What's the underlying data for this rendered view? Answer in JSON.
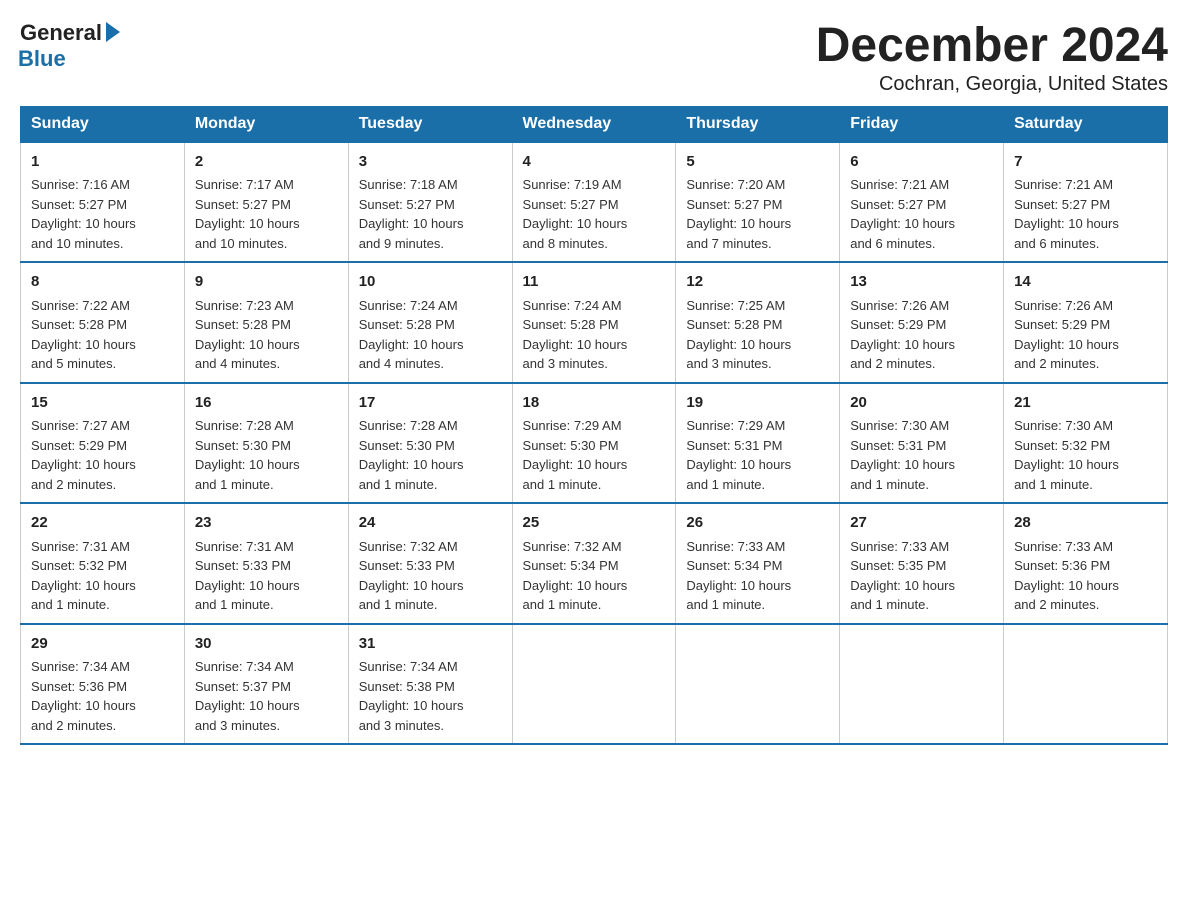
{
  "header": {
    "logo_general": "General",
    "logo_blue": "Blue",
    "month": "December 2024",
    "location": "Cochran, Georgia, United States"
  },
  "days_of_week": [
    "Sunday",
    "Monday",
    "Tuesday",
    "Wednesday",
    "Thursday",
    "Friday",
    "Saturday"
  ],
  "weeks": [
    [
      {
        "day": "1",
        "sunrise": "7:16 AM",
        "sunset": "5:27 PM",
        "daylight": "10 hours and 10 minutes."
      },
      {
        "day": "2",
        "sunrise": "7:17 AM",
        "sunset": "5:27 PM",
        "daylight": "10 hours and 10 minutes."
      },
      {
        "day": "3",
        "sunrise": "7:18 AM",
        "sunset": "5:27 PM",
        "daylight": "10 hours and 9 minutes."
      },
      {
        "day": "4",
        "sunrise": "7:19 AM",
        "sunset": "5:27 PM",
        "daylight": "10 hours and 8 minutes."
      },
      {
        "day": "5",
        "sunrise": "7:20 AM",
        "sunset": "5:27 PM",
        "daylight": "10 hours and 7 minutes."
      },
      {
        "day": "6",
        "sunrise": "7:21 AM",
        "sunset": "5:27 PM",
        "daylight": "10 hours and 6 minutes."
      },
      {
        "day": "7",
        "sunrise": "7:21 AM",
        "sunset": "5:27 PM",
        "daylight": "10 hours and 6 minutes."
      }
    ],
    [
      {
        "day": "8",
        "sunrise": "7:22 AM",
        "sunset": "5:28 PM",
        "daylight": "10 hours and 5 minutes."
      },
      {
        "day": "9",
        "sunrise": "7:23 AM",
        "sunset": "5:28 PM",
        "daylight": "10 hours and 4 minutes."
      },
      {
        "day": "10",
        "sunrise": "7:24 AM",
        "sunset": "5:28 PM",
        "daylight": "10 hours and 4 minutes."
      },
      {
        "day": "11",
        "sunrise": "7:24 AM",
        "sunset": "5:28 PM",
        "daylight": "10 hours and 3 minutes."
      },
      {
        "day": "12",
        "sunrise": "7:25 AM",
        "sunset": "5:28 PM",
        "daylight": "10 hours and 3 minutes."
      },
      {
        "day": "13",
        "sunrise": "7:26 AM",
        "sunset": "5:29 PM",
        "daylight": "10 hours and 2 minutes."
      },
      {
        "day": "14",
        "sunrise": "7:26 AM",
        "sunset": "5:29 PM",
        "daylight": "10 hours and 2 minutes."
      }
    ],
    [
      {
        "day": "15",
        "sunrise": "7:27 AM",
        "sunset": "5:29 PM",
        "daylight": "10 hours and 2 minutes."
      },
      {
        "day": "16",
        "sunrise": "7:28 AM",
        "sunset": "5:30 PM",
        "daylight": "10 hours and 1 minute."
      },
      {
        "day": "17",
        "sunrise": "7:28 AM",
        "sunset": "5:30 PM",
        "daylight": "10 hours and 1 minute."
      },
      {
        "day": "18",
        "sunrise": "7:29 AM",
        "sunset": "5:30 PM",
        "daylight": "10 hours and 1 minute."
      },
      {
        "day": "19",
        "sunrise": "7:29 AM",
        "sunset": "5:31 PM",
        "daylight": "10 hours and 1 minute."
      },
      {
        "day": "20",
        "sunrise": "7:30 AM",
        "sunset": "5:31 PM",
        "daylight": "10 hours and 1 minute."
      },
      {
        "day": "21",
        "sunrise": "7:30 AM",
        "sunset": "5:32 PM",
        "daylight": "10 hours and 1 minute."
      }
    ],
    [
      {
        "day": "22",
        "sunrise": "7:31 AM",
        "sunset": "5:32 PM",
        "daylight": "10 hours and 1 minute."
      },
      {
        "day": "23",
        "sunrise": "7:31 AM",
        "sunset": "5:33 PM",
        "daylight": "10 hours and 1 minute."
      },
      {
        "day": "24",
        "sunrise": "7:32 AM",
        "sunset": "5:33 PM",
        "daylight": "10 hours and 1 minute."
      },
      {
        "day": "25",
        "sunrise": "7:32 AM",
        "sunset": "5:34 PM",
        "daylight": "10 hours and 1 minute."
      },
      {
        "day": "26",
        "sunrise": "7:33 AM",
        "sunset": "5:34 PM",
        "daylight": "10 hours and 1 minute."
      },
      {
        "day": "27",
        "sunrise": "7:33 AM",
        "sunset": "5:35 PM",
        "daylight": "10 hours and 1 minute."
      },
      {
        "day": "28",
        "sunrise": "7:33 AM",
        "sunset": "5:36 PM",
        "daylight": "10 hours and 2 minutes."
      }
    ],
    [
      {
        "day": "29",
        "sunrise": "7:34 AM",
        "sunset": "5:36 PM",
        "daylight": "10 hours and 2 minutes."
      },
      {
        "day": "30",
        "sunrise": "7:34 AM",
        "sunset": "5:37 PM",
        "daylight": "10 hours and 3 minutes."
      },
      {
        "day": "31",
        "sunrise": "7:34 AM",
        "sunset": "5:38 PM",
        "daylight": "10 hours and 3 minutes."
      },
      null,
      null,
      null,
      null
    ]
  ],
  "labels": {
    "sunrise": "Sunrise:",
    "sunset": "Sunset:",
    "daylight": "Daylight:"
  }
}
